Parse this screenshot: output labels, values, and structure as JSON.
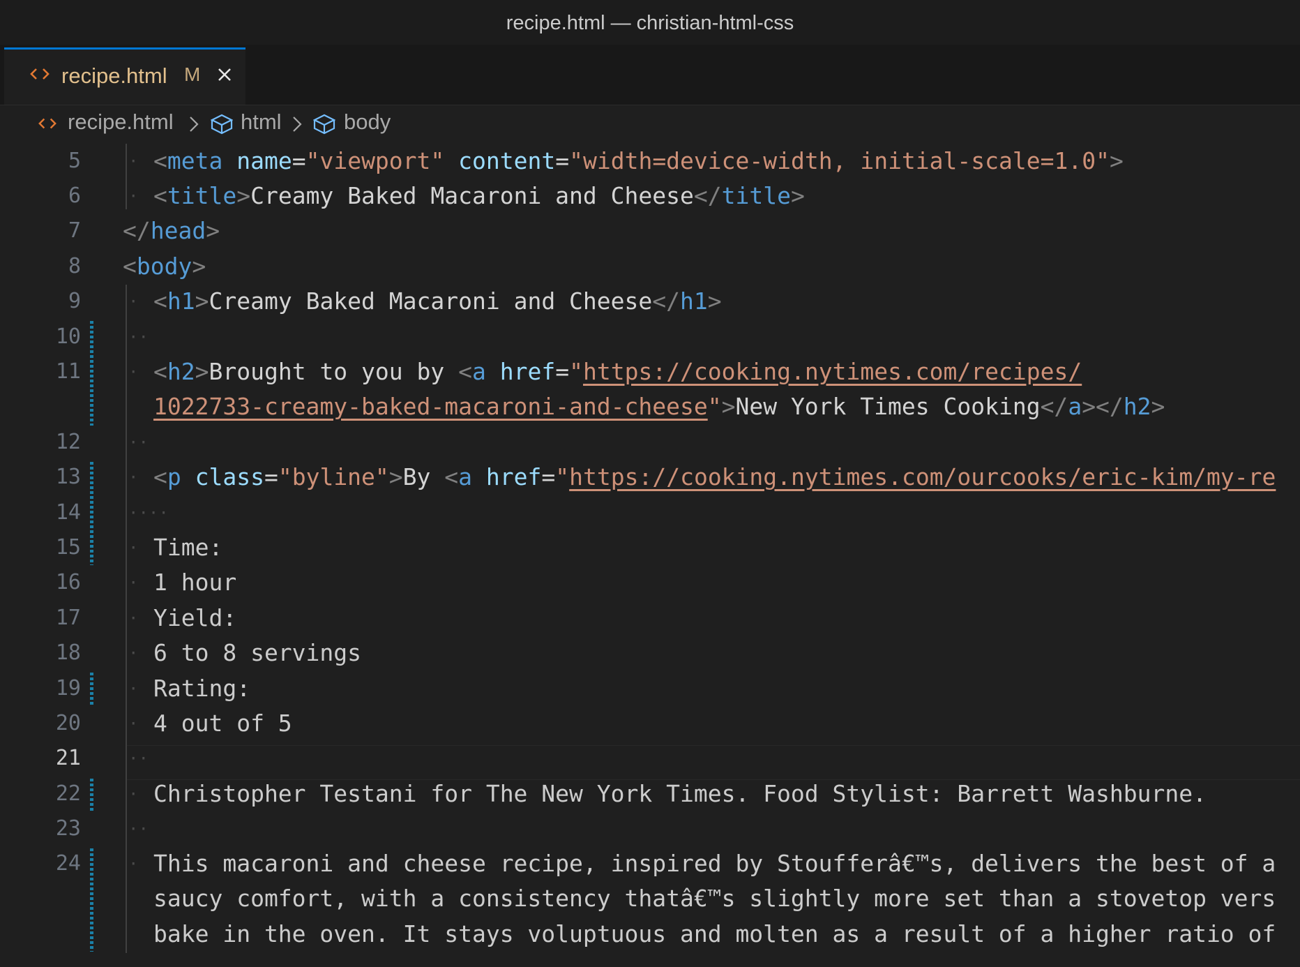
{
  "window": {
    "title": "recipe.html — christian-html-css"
  },
  "tab": {
    "name": "recipe.html",
    "modified": "M"
  },
  "breadcrumb": {
    "file": "recipe.html",
    "sep": ">",
    "html": "html",
    "body": "body"
  },
  "lines": [
    {
      "n": "5"
    },
    {
      "n": "6"
    },
    {
      "n": "7"
    },
    {
      "n": "8"
    },
    {
      "n": "9"
    },
    {
      "n": "10"
    },
    {
      "n": "11"
    },
    {
      "n": ""
    },
    {
      "n": "12"
    },
    {
      "n": "13"
    },
    {
      "n": "14"
    },
    {
      "n": "15"
    },
    {
      "n": "16"
    },
    {
      "n": "17"
    },
    {
      "n": "18"
    },
    {
      "n": "19"
    },
    {
      "n": "20"
    },
    {
      "n": "21"
    },
    {
      "n": "22"
    },
    {
      "n": "23"
    },
    {
      "n": "24"
    }
  ],
  "code": {
    "l5": {
      "tag": "meta",
      "attr1": "name",
      "val1": "\"viewport\"",
      "attr2": "content",
      "val2": "\"width=device-width, initial-scale=1.0\""
    },
    "l6": {
      "tag": "title",
      "text": "Creamy Baked Macaroni and Cheese"
    },
    "l7": {
      "tag": "head"
    },
    "l8": {
      "tag": "body"
    },
    "l9": {
      "tag": "h1",
      "text": "Creamy Baked Macaroni and Cheese"
    },
    "l11": {
      "tag": "h2",
      "text": "Brought to you by ",
      "atag": "a",
      "attr": "href",
      "url1": "https://cooking.nytimes.com/recipes/",
      "url2": "1022733-creamy-baked-macaroni-and-cheese",
      "link": "New York Times Cooking"
    },
    "l13": {
      "tag": "p",
      "attr": "class",
      "val": "\"byline\"",
      "text": "By ",
      "atag": "a",
      "attr2": "href",
      "url": "https://cooking.nytimes.com/ourcooks/eric-kim/my-re"
    },
    "l15": "Time:",
    "l16": "1 hour",
    "l17": "Yield:",
    "l18": "6 to 8 servings",
    "l19": "Rating:",
    "l20": "4 out of 5",
    "l22": "Christopher Testani for The New York Times. Food Stylist: Barrett Washburne.",
    "l24a": "This macaroni and cheese recipe, inspired by Stoufferâ€™s, delivers the best of a",
    "l24b": "saucy comfort, with a consistency thatâ€™s slightly more set than a stovetop vers",
    "l24c": "bake in the oven. It stays voluptuous and molten as a result of a higher ratio of"
  },
  "colors": {
    "tag": "#569cd6",
    "attr": "#9cdcfe",
    "string": "#ce9178",
    "punct": "#808080",
    "tab_text": "#e2c08d",
    "accent": "#0078d4"
  }
}
